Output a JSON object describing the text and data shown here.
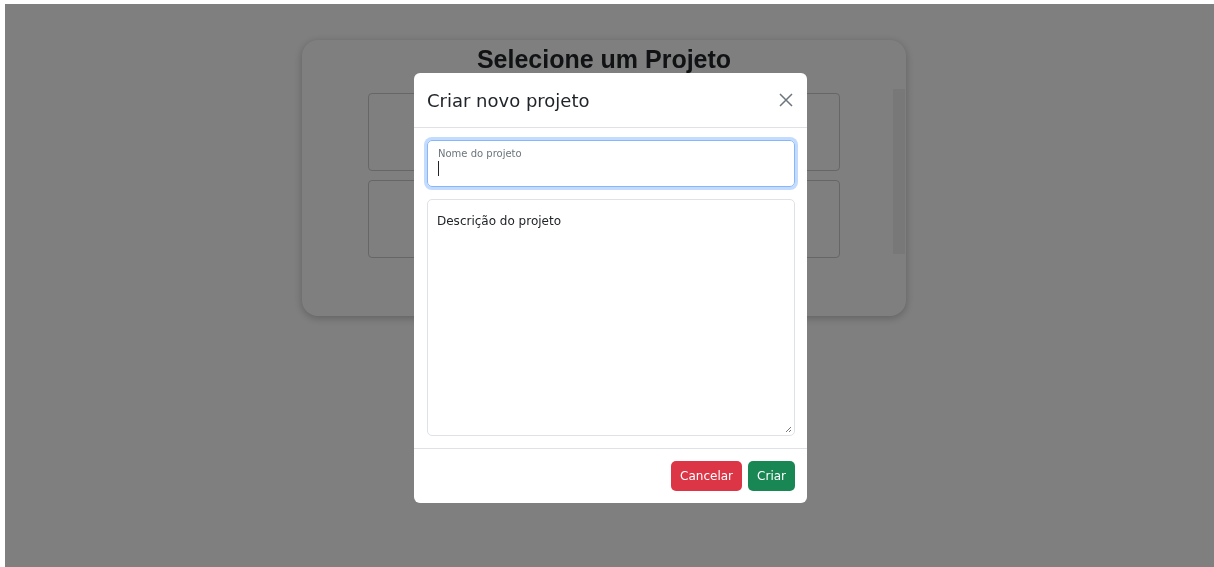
{
  "page": {
    "title": "Selecione um Projeto"
  },
  "modal": {
    "title": "Criar novo projeto",
    "fields": [
      {
        "kind": "floating-input",
        "label": "Nome do projeto",
        "focused": true
      },
      {
        "kind": "textarea",
        "placeholder": "Descrição do projeto",
        "focused": false
      }
    ],
    "buttons": [
      {
        "label": "Cancelar",
        "kind": "danger"
      },
      {
        "label": "Criar",
        "kind": "success"
      }
    ]
  }
}
